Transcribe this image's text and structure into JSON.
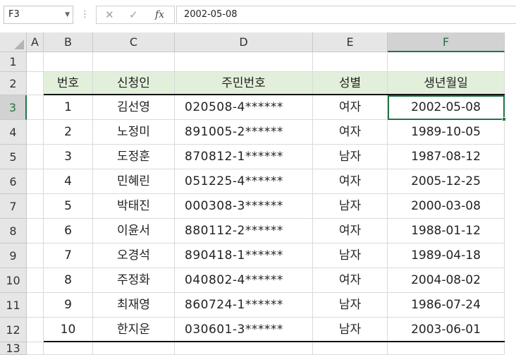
{
  "formula_bar": {
    "name_box": "F3",
    "formula_value": "2002-05-08",
    "cancel_icon": "✕",
    "enter_icon": "✓",
    "fx_label": "fx"
  },
  "columns": [
    "A",
    "B",
    "C",
    "D",
    "E",
    "F"
  ],
  "selected_column": "F",
  "rows": [
    "1",
    "2",
    "3",
    "4",
    "5",
    "6",
    "7",
    "8",
    "9",
    "10",
    "11",
    "12",
    "13"
  ],
  "selected_row": "3",
  "table": {
    "headers": [
      "번호",
      "신청인",
      "주민번호",
      "성별",
      "생년월일"
    ],
    "data": [
      [
        "1",
        "김선영",
        "020508-4******",
        "여자",
        "2002-05-08"
      ],
      [
        "2",
        "노정미",
        "891005-2******",
        "여자",
        "1989-10-05"
      ],
      [
        "3",
        "도정훈",
        "870812-1******",
        "남자",
        "1987-08-12"
      ],
      [
        "4",
        "민혜린",
        "051225-4******",
        "여자",
        "2005-12-25"
      ],
      [
        "5",
        "박태진",
        "000308-3******",
        "남자",
        "2000-03-08"
      ],
      [
        "6",
        "이윤서",
        "880112-2******",
        "여자",
        "1988-01-12"
      ],
      [
        "7",
        "오경석",
        "890418-1******",
        "남자",
        "1989-04-18"
      ],
      [
        "8",
        "주정화",
        "040802-4******",
        "여자",
        "2004-08-02"
      ],
      [
        "9",
        "최재영",
        "860724-1******",
        "남자",
        "1986-07-24"
      ],
      [
        "10",
        "한지운",
        "030601-3******",
        "남자",
        "2003-06-01"
      ]
    ]
  },
  "colors": {
    "header_fill": "#e2efda",
    "selection": "#217346"
  }
}
